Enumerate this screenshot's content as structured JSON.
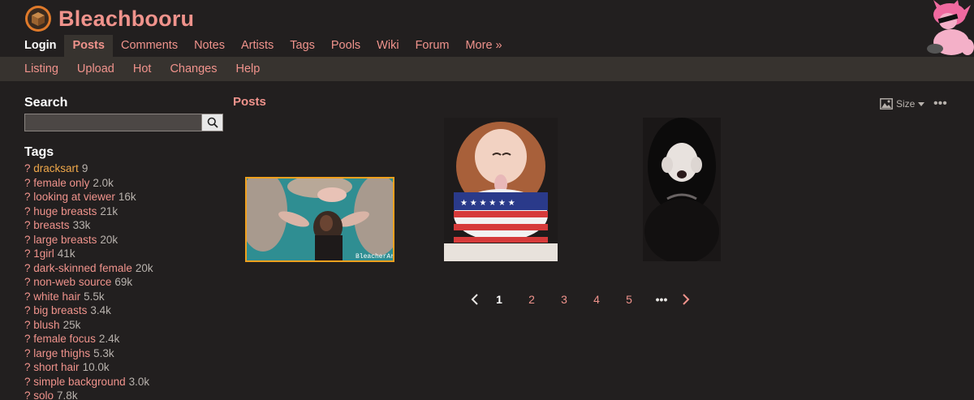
{
  "site": {
    "name": "Bleachbooru"
  },
  "main_nav": [
    {
      "label": "Login"
    },
    {
      "label": "Posts"
    },
    {
      "label": "Comments"
    },
    {
      "label": "Notes"
    },
    {
      "label": "Artists"
    },
    {
      "label": "Tags"
    },
    {
      "label": "Pools"
    },
    {
      "label": "Wiki"
    },
    {
      "label": "Forum"
    },
    {
      "label": "More »"
    }
  ],
  "sub_nav": [
    {
      "label": "Listing"
    },
    {
      "label": "Upload"
    },
    {
      "label": "Hot"
    },
    {
      "label": "Changes"
    },
    {
      "label": "Help"
    }
  ],
  "sidebar": {
    "search_title": "Search",
    "search_value": "",
    "tags_title": "Tags",
    "tags": [
      {
        "q": "?",
        "name": "dracksart",
        "count": "9"
      },
      {
        "q": "?",
        "name": "female only",
        "count": "2.0k"
      },
      {
        "q": "?",
        "name": "looking at viewer",
        "count": "16k"
      },
      {
        "q": "?",
        "name": "huge breasts",
        "count": "21k"
      },
      {
        "q": "?",
        "name": "breasts",
        "count": "33k"
      },
      {
        "q": "?",
        "name": "large breasts",
        "count": "20k"
      },
      {
        "q": "?",
        "name": "1girl",
        "count": "41k"
      },
      {
        "q": "?",
        "name": "dark-skinned female",
        "count": "20k"
      },
      {
        "q": "?",
        "name": "non-web source",
        "count": "69k"
      },
      {
        "q": "?",
        "name": "white hair",
        "count": "5.5k"
      },
      {
        "q": "?",
        "name": "big breasts",
        "count": "3.4k"
      },
      {
        "q": "?",
        "name": "blush",
        "count": "25k"
      },
      {
        "q": "?",
        "name": "female focus",
        "count": "2.4k"
      },
      {
        "q": "?",
        "name": "large thighs",
        "count": "5.3k"
      },
      {
        "q": "?",
        "name": "short hair",
        "count": "10.0k"
      },
      {
        "q": "?",
        "name": "simple background",
        "count": "3.0k"
      },
      {
        "q": "?",
        "name": "solo",
        "count": "7.8k"
      }
    ]
  },
  "posts": {
    "title": "Posts",
    "size_label": "Size",
    "more_label": "•••",
    "thumb1_watermark": "BleacherArt"
  },
  "paginator": {
    "pages": [
      "1",
      "2",
      "3",
      "4",
      "5"
    ],
    "ellipsis": "•••"
  },
  "colors": {
    "link": "#f0938c",
    "artist": "#f0a84a",
    "bg": "#221f1f",
    "nav_bg": "#37332f",
    "highlight_border": "#f0a01e"
  }
}
